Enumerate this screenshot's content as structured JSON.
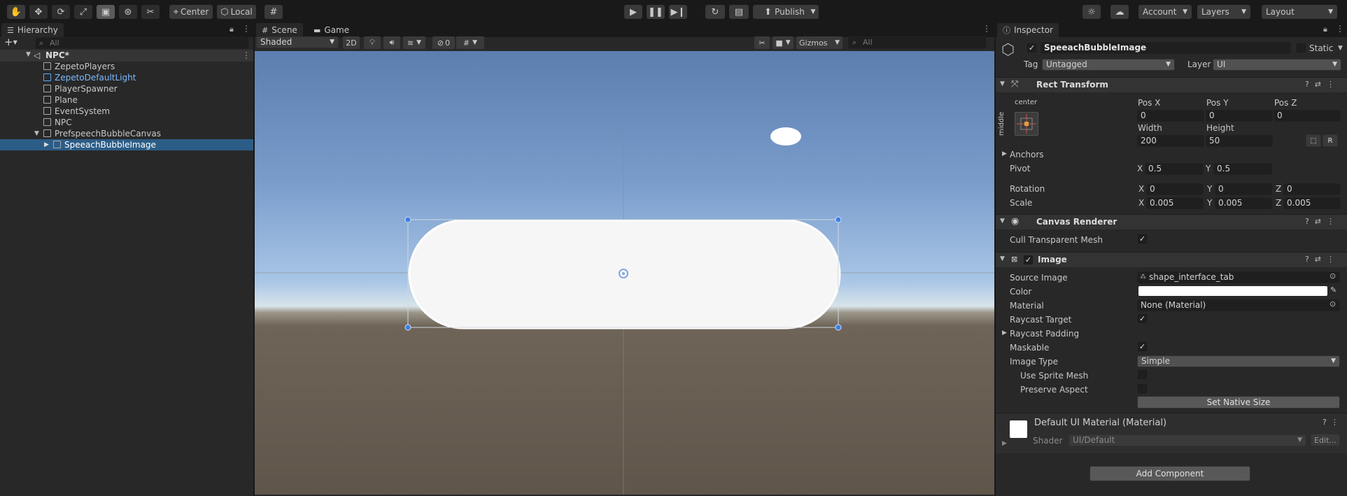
{
  "toolbar": {
    "pivot_label": "Center",
    "space_label": "Local",
    "publish_label": "Publish",
    "account_label": "Account",
    "layers_label": "Layers",
    "layout_label": "Layout"
  },
  "hierarchy": {
    "tab_label": "Hierarchy",
    "search_placeholder": "All",
    "scene_name": "NPC*",
    "items": [
      {
        "label": "ZepetoPlayers"
      },
      {
        "label": "ZepetoDefaultLight"
      },
      {
        "label": "PlayerSpawner"
      },
      {
        "label": "Plane"
      },
      {
        "label": "EventSystem"
      },
      {
        "label": "NPC"
      },
      {
        "label": "PrefspeechBubbleCanvas"
      },
      {
        "label": "SpeeachBubbleImage"
      }
    ]
  },
  "scene": {
    "tab_scene": "Scene",
    "tab_game": "Game",
    "shading_mode": "Shaded",
    "mode_2d": "2D",
    "hidden_count": "0",
    "gizmos_label": "Gizmos",
    "search_placeholder": "All"
  },
  "inspector": {
    "tab_label": "Inspector",
    "object_name": "SpeeachBubbleImage",
    "static_label": "Static",
    "tag_label": "Tag",
    "tag_value": "Untagged",
    "layer_label": "Layer",
    "layer_value": "UI",
    "rect_transform": {
      "title": "Rect Transform",
      "anchor_h": "center",
      "anchor_v": "middle",
      "pos_x_label": "Pos X",
      "pos_x": "0",
      "pos_y_label": "Pos Y",
      "pos_y": "0",
      "pos_z_label": "Pos Z",
      "pos_z": "0",
      "width_label": "Width",
      "width": "200",
      "height_label": "Height",
      "height": "50",
      "r_label": "R",
      "anchors_label": "Anchors",
      "pivot_label": "Pivot",
      "pivot_x": "0.5",
      "pivot_y": "0.5",
      "rotation_label": "Rotation",
      "rot_x": "0",
      "rot_y": "0",
      "rot_z": "0",
      "scale_label": "Scale",
      "scale_x": "0.005",
      "scale_y": "0.005",
      "scale_z": "0.005",
      "x": "X",
      "y": "Y",
      "z": "Z"
    },
    "canvas_renderer": {
      "title": "Canvas Renderer",
      "cull_label": "Cull Transparent Mesh"
    },
    "image": {
      "title": "Image",
      "source_label": "Source Image",
      "source_value": "shape_interface_tab",
      "color_label": "Color",
      "color_value": "#ffffff",
      "material_label": "Material",
      "material_value": "None (Material)",
      "raycast_target_label": "Raycast Target",
      "raycast_padding_label": "Raycast Padding",
      "maskable_label": "Maskable",
      "image_type_label": "Image Type",
      "image_type_value": "Simple",
      "use_sprite_mesh_label": "Use Sprite Mesh",
      "preserve_aspect_label": "Preserve Aspect",
      "native_size_label": "Set Native Size"
    },
    "material": {
      "title": "Default UI Material (Material)",
      "shader_label": "Shader",
      "shader_value": "UI/Default",
      "edit_label": "Edit..."
    },
    "add_component_label": "Add Component"
  }
}
